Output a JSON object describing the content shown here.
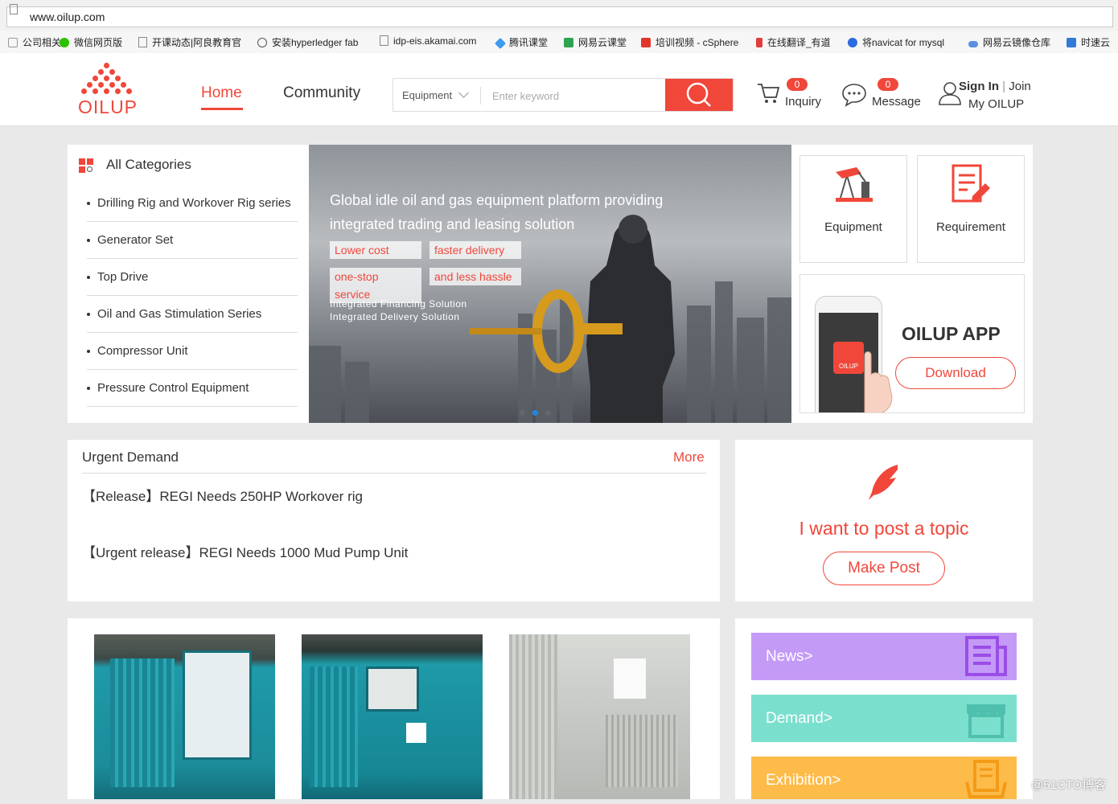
{
  "browser": {
    "url": "www.oilup.com",
    "bookmarks": [
      "公司相关",
      "微信网页版",
      "开课动态|阿良教育官",
      "安装hyperledger fab",
      "idp-eis.akamai.com",
      "腾讯课堂",
      "网易云课堂",
      "培训视频 - cSphere",
      "在线翻译_有道",
      "将navicat for mysql",
      "网易云镜像仓库",
      "时速云"
    ]
  },
  "header": {
    "logo": "OILUP",
    "nav": {
      "home": "Home",
      "community": "Community"
    },
    "search": {
      "category": "Equipment",
      "placeholder": "Enter keyword"
    },
    "inquiry": {
      "count": "0",
      "label": "Inquiry"
    },
    "message": {
      "count": "0",
      "label": "Message"
    },
    "account": {
      "sign_in": "Sign In",
      "separator": "|",
      "join": "Join",
      "my": "My OILUP"
    }
  },
  "categories": {
    "title": "All Categories",
    "items": [
      "Drilling Rig and Workover Rig series",
      "Generator Set",
      "Top Drive",
      "Oil and Gas Stimulation Series",
      "Compressor Unit",
      "Pressure Control Equipment"
    ]
  },
  "banner": {
    "headline_1": "Global idle oil and gas equipment platform providing",
    "headline_2": "integrated trading and leasing solution",
    "tags": [
      "Lower cost",
      "faster delivery",
      "one-stop service",
      "and less hassle"
    ],
    "sub_1": "Integrated Financing Solution",
    "sub_2": "Integrated Delivery Solution"
  },
  "quick": {
    "equipment": "Equipment",
    "requirement": "Requirement",
    "app_title": "OILUP APP",
    "download": "Download",
    "phone_logo": "OILUP"
  },
  "urgent": {
    "title": "Urgent Demand",
    "more": "More",
    "items": [
      "【Release】REGI Needs 250HP Workover rig",
      "【Urgent release】REGI Needs 1000 Mud Pump Unit"
    ]
  },
  "post": {
    "prompt": "I want to post a topic",
    "button": "Make Post"
  },
  "side_links": {
    "news": "News>",
    "demand": "Demand>",
    "exhibition": "Exhibition>"
  },
  "watermark": "@51CTO博客",
  "colors": {
    "brand": "#f0473a",
    "news": "#c49af7",
    "demand": "#7bdfce",
    "exhibition": "#fdbb4a"
  }
}
